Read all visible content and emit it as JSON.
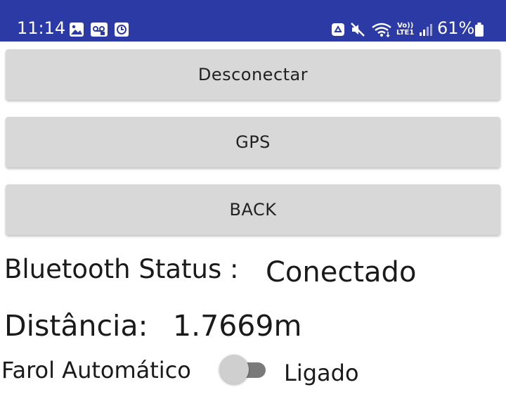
{
  "status_bar": {
    "time": "11:14",
    "battery": "61%",
    "bar_color": "#2b3aa5",
    "left_icons": [
      "gallery-icon",
      "voicemail-icon",
      "clock-icon"
    ],
    "right_icons": [
      "recycle-icon",
      "mute-icon",
      "wifi-icon",
      "volte-icon",
      "signal-icon",
      "battery-icon"
    ],
    "volte_label_top": "Vo))",
    "volte_label_bottom": "LTE1"
  },
  "buttons": {
    "disconnect": "Desconectar",
    "gps": "GPS",
    "back": "BACK"
  },
  "bluetooth": {
    "label": "Bluetooth Status :",
    "value": "Conectado"
  },
  "distance": {
    "label": "Distância:",
    "value": "1.7669m"
  },
  "auto_light": {
    "label": "Farol Automático",
    "state": "Ligado",
    "switch_on": false
  }
}
